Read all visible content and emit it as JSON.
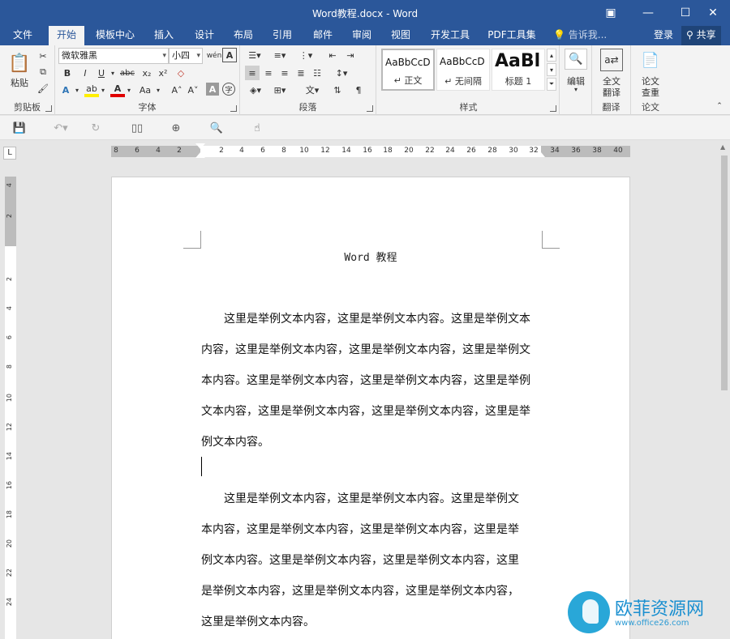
{
  "window": {
    "title": "Word教程.docx - Word"
  },
  "window_buttons": [
    "▣",
    "—",
    "☐",
    "✕"
  ],
  "tabs": [
    {
      "label": "文件"
    },
    {
      "label": "开始"
    },
    {
      "label": "模板中心"
    },
    {
      "label": "插入"
    },
    {
      "label": "设计"
    },
    {
      "label": "布局"
    },
    {
      "label": "引用"
    },
    {
      "label": "邮件"
    },
    {
      "label": "审阅"
    },
    {
      "label": "视图"
    },
    {
      "label": "开发工具"
    },
    {
      "label": "PDF工具集"
    }
  ],
  "tell_me": "告诉我...",
  "login": "登录",
  "share": "共享",
  "ribbon": {
    "clipboard": {
      "label": "剪贴板",
      "paste": "粘贴"
    },
    "font": {
      "label": "字体",
      "font_name": "微软雅黑",
      "font_size": "小四",
      "wen": "wén",
      "a_box": "A",
      "bold": "B",
      "italic": "I",
      "underline": "U",
      "strike": "abc",
      "sub": "x₂",
      "sup": "x²",
      "text_effect": "A",
      "highlight": "ab",
      "font_color": "A",
      "aa": "Aa",
      "grow": "A˄",
      "shrink": "A˅",
      "char_shade": "A",
      "enclose": "字"
    },
    "paragraph": {
      "label": "段落"
    },
    "styles": {
      "label": "样式",
      "items": [
        {
          "sample": "AaBbCcD",
          "name": "↵ 正文"
        },
        {
          "sample": "AaBbCcD",
          "name": "↵ 无间隔"
        },
        {
          "sample": "AaBl",
          "name": "标题 1"
        }
      ]
    },
    "editing": {
      "label": "编辑",
      "sub": "编辑"
    },
    "translate": {
      "label": "翻译",
      "btn_line1": "全文",
      "btn_line2": "翻译"
    },
    "paper": {
      "label": "论文",
      "btn_line1": "论文",
      "btn_line2": "查重"
    }
  },
  "ruler": {
    "corner": "L",
    "h_left": [
      "8",
      "6",
      "4",
      "2"
    ],
    "h_main": [
      "2",
      "4",
      "6",
      "8",
      "10",
      "12",
      "14",
      "16",
      "18",
      "20",
      "22",
      "24",
      "26",
      "28",
      "30",
      "32"
    ],
    "h_right": [
      "34",
      "36",
      "38",
      "40"
    ],
    "v_labels": [
      "4",
      "2",
      "2",
      "4",
      "6",
      "8",
      "10",
      "12",
      "14",
      "16",
      "18",
      "20",
      "22",
      "24"
    ]
  },
  "document": {
    "title": "Word 教程",
    "para1": [
      "　　这里是举例文本内容，这里是举例文本内容。这里是举例文本",
      "内容，这里是举例文本内容，这里是举例文本内容，这里是举例文",
      "本内容。这里是举例文本内容，这里是举例文本内容，这里是举例",
      "文本内容，这里是举例文本内容，这里是举例文本内容，这里是举",
      "例文本内容。"
    ],
    "para2": [
      "　　这里是举例文本内容，这里是举例文本内容。这里是举例文",
      "本内容，这里是举例文本内容，这里是举例文本内容，这里是举",
      "例文本内容。这里是举例文本内容，这里是举例文本内容，这里",
      "是举例文本内容，这里是举例文本内容，这里是举例文本内容，",
      "这里是举例文本内容。"
    ]
  },
  "watermark": {
    "text": "欧菲资源网",
    "sub": "www.office26.com"
  },
  "colors": {
    "title_bar": "#2b579a",
    "ribbon": "#f3f3f3",
    "workspace": "#e6e6e6"
  }
}
